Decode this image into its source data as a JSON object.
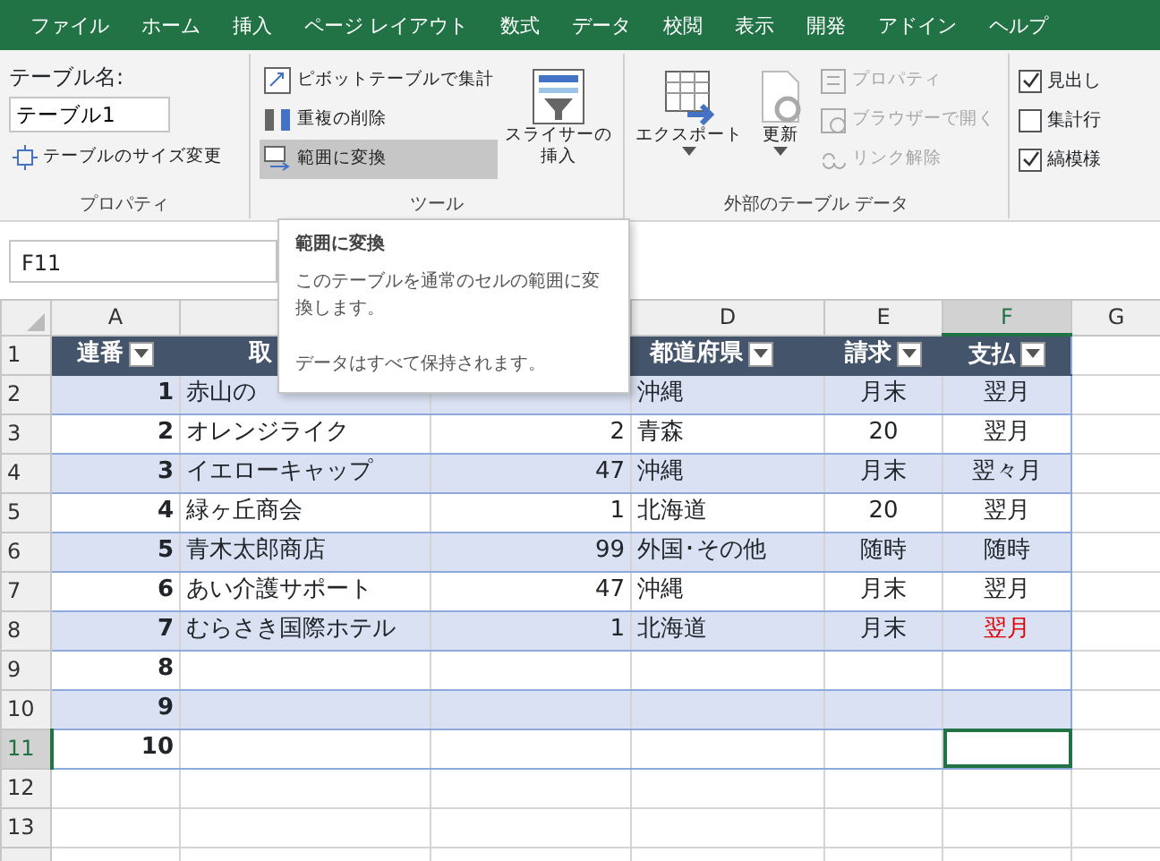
{
  "menu_tabs": [
    {
      "label": "ファイル"
    },
    {
      "label": "ホーム"
    },
    {
      "label": "挿入"
    },
    {
      "label": "ページ レイアウト"
    },
    {
      "label": "数式"
    },
    {
      "label": "データ"
    },
    {
      "label": "校閲"
    },
    {
      "label": "表示"
    },
    {
      "label": "開発"
    },
    {
      "label": "アドイン"
    },
    {
      "label": "ヘルプ"
    }
  ],
  "ribbon": {
    "properties": {
      "name_label": "テーブル名:",
      "name_value": "テーブル1",
      "resize_button": "テーブルのサイズ変更",
      "group_label": "プロパティ"
    },
    "tools": {
      "buttons": [
        {
          "label": "ピボットテーブルで集計",
          "highlighted": false
        },
        {
          "label": "重複の削除",
          "highlighted": false
        },
        {
          "label": "範囲に変換",
          "highlighted": true
        }
      ],
      "slicer_button": [
        "スライサーの",
        "挿入"
      ],
      "group_label": "ツール"
    },
    "external_data": {
      "large_buttons": [
        {
          "label": "エクスポート",
          "disabled": false
        },
        {
          "label": "更新",
          "disabled": false
        }
      ],
      "small_buttons": [
        {
          "label": "プロパティ",
          "disabled": true
        },
        {
          "label": "ブラウザーで開く",
          "disabled": true
        },
        {
          "label": "リンク解除",
          "disabled": true
        }
      ],
      "group_label": "外部のテーブル データ"
    },
    "style_options": [
      {
        "label": "見出し",
        "checked": true
      },
      {
        "label": "集計行",
        "checked": false
      },
      {
        "label": "縞模様",
        "checked": true
      }
    ]
  },
  "name_box": "F11",
  "tooltip": {
    "title": "範囲に変換",
    "description": "このテーブルを通常のセルの範囲に変換します。",
    "note": "データはすべて保持されます。"
  },
  "column_headers": [
    {
      "label": "A",
      "selected": false
    },
    {
      "label": "D",
      "selected": false
    },
    {
      "label": "E",
      "selected": false
    },
    {
      "label": "F",
      "selected": true
    },
    {
      "label": "G",
      "selected": false
    }
  ],
  "rows": [
    {
      "number": "1",
      "kind": "header",
      "selected": false,
      "cells": [
        {
          "text": "連番",
          "filter": true
        },
        {
          "text": "取"
        },
        null,
        {
          "text": "都道府県",
          "filter": true
        },
        {
          "text": "請求",
          "filter": true
        },
        {
          "text": "支払",
          "filter": true
        }
      ]
    },
    {
      "number": "2",
      "kind": "data",
      "banded": true,
      "selected": false,
      "cells": [
        "1",
        "赤山の",
        null,
        "沖縄",
        "月末",
        "翌月"
      ]
    },
    {
      "number": "3",
      "kind": "data",
      "banded": false,
      "selected": false,
      "cells": [
        "2",
        "オレンジライク",
        "2",
        "青森",
        "20",
        "翌月"
      ]
    },
    {
      "number": "4",
      "kind": "data",
      "banded": true,
      "selected": false,
      "cells": [
        "3",
        "イエローキャップ",
        "47",
        "沖縄",
        "月末",
        "翌々月"
      ]
    },
    {
      "number": "5",
      "kind": "data",
      "banded": false,
      "selected": false,
      "cells": [
        "4",
        "緑ヶ丘商会",
        "1",
        "北海道",
        "20",
        "翌月"
      ]
    },
    {
      "number": "6",
      "kind": "data",
      "banded": true,
      "selected": false,
      "cells": [
        "5",
        "青木太郎商店",
        "99",
        "外国･その他",
        "随時",
        "随時"
      ]
    },
    {
      "number": "7",
      "kind": "data",
      "banded": false,
      "selected": false,
      "cells": [
        "6",
        "あい介護サポート",
        "47",
        "沖縄",
        "月末",
        "翌月"
      ]
    },
    {
      "number": "8",
      "kind": "data",
      "banded": true,
      "selected": false,
      "cells": [
        "7",
        "むらさき国際ホテル",
        "1",
        "北海道",
        "月末",
        {
          "text": "翌月",
          "color": "#e00000"
        }
      ]
    },
    {
      "number": "9",
      "kind": "data",
      "banded": false,
      "selected": false,
      "cells": [
        "8",
        null,
        null,
        null,
        null,
        null
      ]
    },
    {
      "number": "10",
      "kind": "data",
      "banded": true,
      "selected": false,
      "cells": [
        "9",
        null,
        null,
        null,
        null,
        null
      ]
    },
    {
      "number": "11",
      "kind": "data",
      "banded": false,
      "selected": true,
      "cells": [
        "10",
        null,
        null,
        null,
        null,
        {
          "selected": true
        }
      ]
    },
    {
      "number": "12",
      "kind": "plain",
      "selected": false
    },
    {
      "number": "13",
      "kind": "plain",
      "selected": false
    }
  ]
}
